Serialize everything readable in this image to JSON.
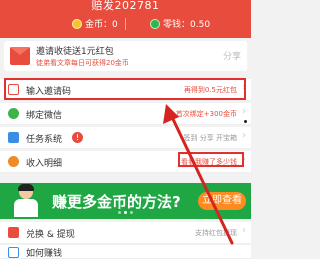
{
  "header": {
    "user_id": "赔发202781",
    "coin_label": "金币：0",
    "change_label": "零钱：0.50"
  },
  "invite_banner": {
    "title": "邀请收徒送1元红包",
    "subtitle": "徒弟看文章每日可获得20金币",
    "share_text": "分享"
  },
  "menu": [
    {
      "label": "输入邀请码",
      "right": "再得到0.5元红包",
      "icon": "invite-code-icon"
    },
    {
      "label": "绑定微信",
      "right": "首次绑定+300金币",
      "icon": "wechat-icon"
    },
    {
      "label": "任务系统",
      "right": "签到 分享 开宝箱",
      "icon": "task-icon",
      "badge": "!"
    },
    {
      "label": "收入明细",
      "right": "看看我赚了多少钱",
      "icon": "income-icon"
    }
  ],
  "promo": {
    "title": "赚更多金币的方法?",
    "button": "立即查看"
  },
  "menu2": [
    {
      "label": "兑换 & 提现",
      "right": "支持红包提现",
      "icon": "exchange-icon"
    },
    {
      "label": "如何赚钱",
      "right": "",
      "icon": "how-to-earn-icon"
    }
  ],
  "colors": {
    "brand": "#e84c3d",
    "banner_green": "#1fa744",
    "highlight": "#e03030",
    "button_orange": "#ff8a1f"
  }
}
